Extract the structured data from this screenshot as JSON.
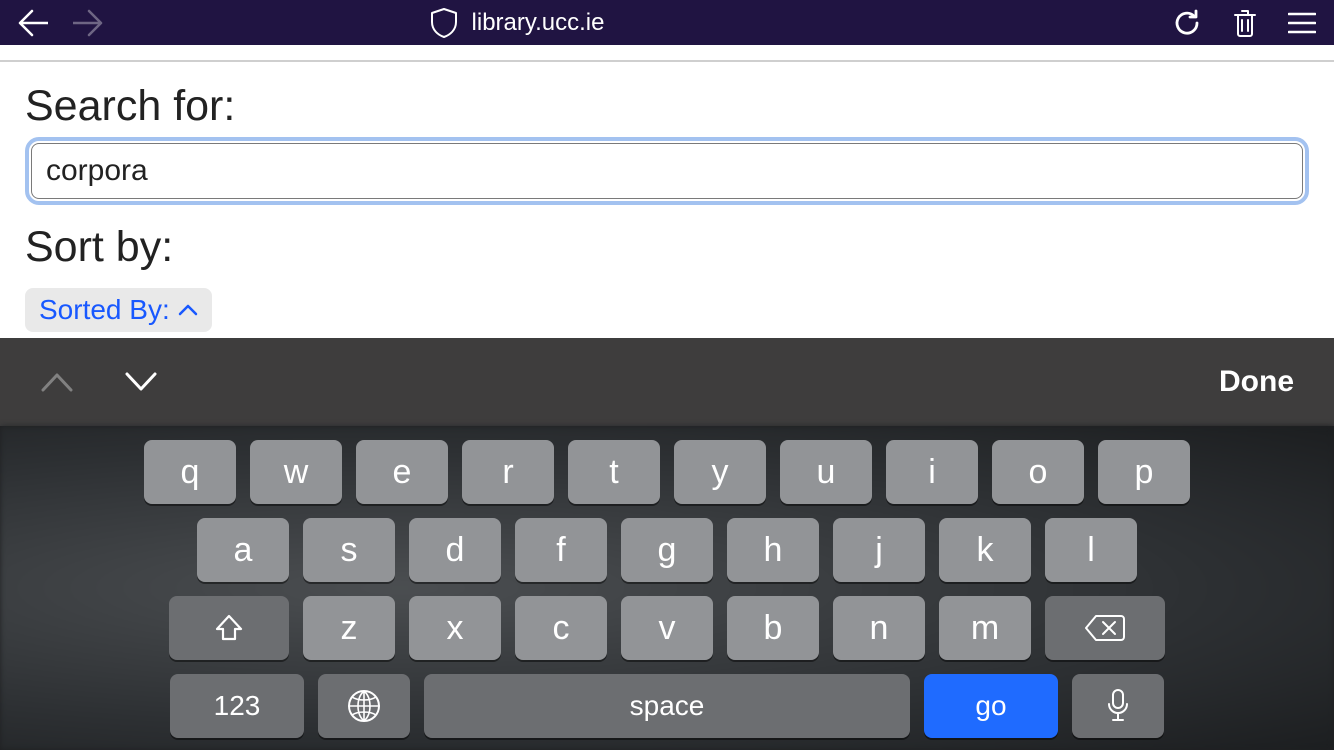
{
  "browser": {
    "url": "library.ucc.ie"
  },
  "page": {
    "search_label": "Search for:",
    "search_value": "corpora",
    "sort_label": "Sort by:",
    "sort_chip": "Sorted By:"
  },
  "keyboard": {
    "done_label": "Done",
    "row1": [
      "q",
      "w",
      "e",
      "r",
      "t",
      "y",
      "u",
      "i",
      "o",
      "p"
    ],
    "row2": [
      "a",
      "s",
      "d",
      "f",
      "g",
      "h",
      "j",
      "k",
      "l"
    ],
    "row3": [
      "z",
      "x",
      "c",
      "v",
      "b",
      "n",
      "m"
    ],
    "numsym": "123",
    "space": "space",
    "go": "go"
  }
}
